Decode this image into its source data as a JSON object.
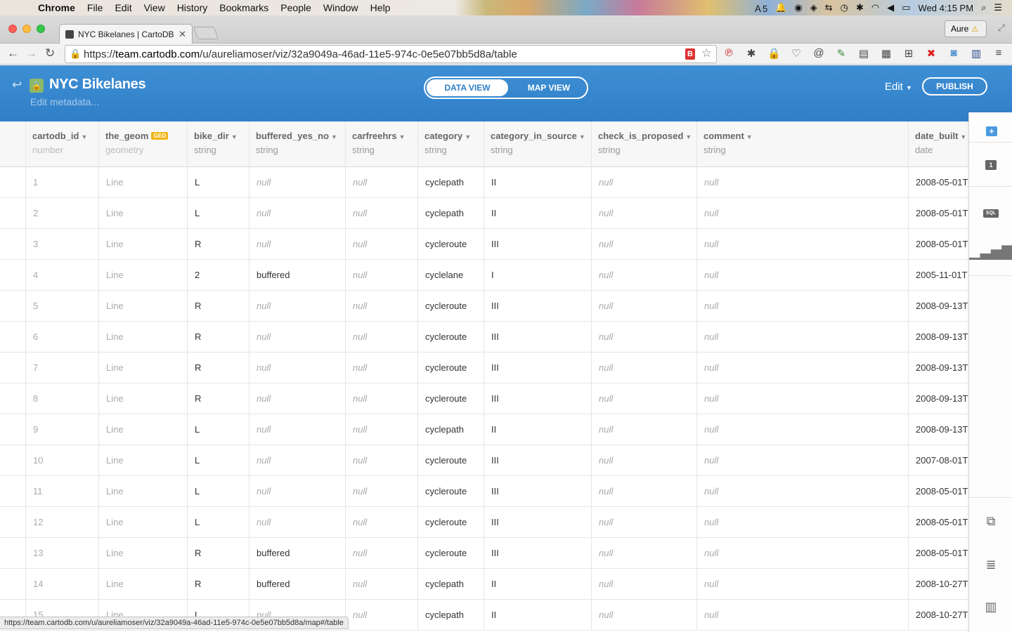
{
  "menubar": {
    "app": "Chrome",
    "items": [
      "File",
      "Edit",
      "View",
      "History",
      "Bookmarks",
      "People",
      "Window",
      "Help"
    ],
    "status_count": "5",
    "clock": "Wed 4:15 PM"
  },
  "browser": {
    "tab_title": "NYC Bikelanes | CartoDB",
    "profile": "Aure",
    "url_prefix": "https://",
    "url_host": "team.cartodb.com",
    "url_path": "/u/aureliamoser/viz/32a9049a-46ad-11e5-974c-0e5e07bb5d8a/table",
    "status_url": "https://team.cartodb.com/u/aureliamoser/viz/32a9049a-46ad-11e5-974c-0e5e07bb5d8a/map#/table"
  },
  "header": {
    "title": "NYC Bikelanes",
    "metadata_link": "Edit metadata...",
    "data_view": "DATA VIEW",
    "map_view": "MAP VIEW",
    "edit": "Edit",
    "publish": "PUBLISH"
  },
  "table": {
    "columns": [
      {
        "name": "cartodb_id",
        "type": "number"
      },
      {
        "name": "the_geom",
        "type": "geometry",
        "badge": "GEO"
      },
      {
        "name": "bike_dir",
        "type": "string"
      },
      {
        "name": "buffered_yes_no",
        "type": "string"
      },
      {
        "name": "carfreehrs",
        "type": "string"
      },
      {
        "name": "category",
        "type": "string"
      },
      {
        "name": "category_in_source",
        "type": "string"
      },
      {
        "name": "check_is_proposed",
        "type": "string"
      },
      {
        "name": "comment",
        "type": "string"
      },
      {
        "name": "date_built",
        "type": "date"
      }
    ],
    "rows": [
      [
        "1",
        "Line",
        "L",
        "null",
        "null",
        "cyclepath",
        "II",
        "null",
        "null",
        "2008-05-01T"
      ],
      [
        "2",
        "Line",
        "L",
        "null",
        "null",
        "cyclepath",
        "II",
        "null",
        "null",
        "2008-05-01T"
      ],
      [
        "3",
        "Line",
        "R",
        "null",
        "null",
        "cycleroute",
        "III",
        "null",
        "null",
        "2008-05-01T"
      ],
      [
        "4",
        "Line",
        "2",
        "buffered",
        "null",
        "cyclelane",
        "I",
        "null",
        "null",
        "2005-11-01T"
      ],
      [
        "5",
        "Line",
        "R",
        "null",
        "null",
        "cycleroute",
        "III",
        "null",
        "null",
        "2008-09-13T"
      ],
      [
        "6",
        "Line",
        "R",
        "null",
        "null",
        "cycleroute",
        "III",
        "null",
        "null",
        "2008-09-13T"
      ],
      [
        "7",
        "Line",
        "R",
        "null",
        "null",
        "cycleroute",
        "III",
        "null",
        "null",
        "2008-09-13T"
      ],
      [
        "8",
        "Line",
        "R",
        "null",
        "null",
        "cycleroute",
        "III",
        "null",
        "null",
        "2008-09-13T"
      ],
      [
        "9",
        "Line",
        "L",
        "null",
        "null",
        "cyclepath",
        "II",
        "null",
        "null",
        "2008-09-13T"
      ],
      [
        "10",
        "Line",
        "L",
        "null",
        "null",
        "cycleroute",
        "III",
        "null",
        "null",
        "2007-08-01T"
      ],
      [
        "11",
        "Line",
        "L",
        "null",
        "null",
        "cycleroute",
        "III",
        "null",
        "null",
        "2008-05-01T"
      ],
      [
        "12",
        "Line",
        "L",
        "null",
        "null",
        "cycleroute",
        "III",
        "null",
        "null",
        "2008-05-01T"
      ],
      [
        "13",
        "Line",
        "R",
        "buffered",
        "null",
        "cycleroute",
        "III",
        "null",
        "null",
        "2008-05-01T"
      ],
      [
        "14",
        "Line",
        "R",
        "buffered",
        "null",
        "cyclepath",
        "II",
        "null",
        "null",
        "2008-10-27T"
      ],
      [
        "15",
        "Line",
        "L",
        "null",
        "null",
        "cyclepath",
        "II",
        "null",
        "null",
        "2008-10-27T"
      ]
    ]
  },
  "right_panel": {
    "add_icon": "plus-icon",
    "layer_number": "1",
    "sql_label": "SQL"
  },
  "colors": {
    "header_blue": "#2f7fc8",
    "geo_badge": "#f1b514"
  }
}
